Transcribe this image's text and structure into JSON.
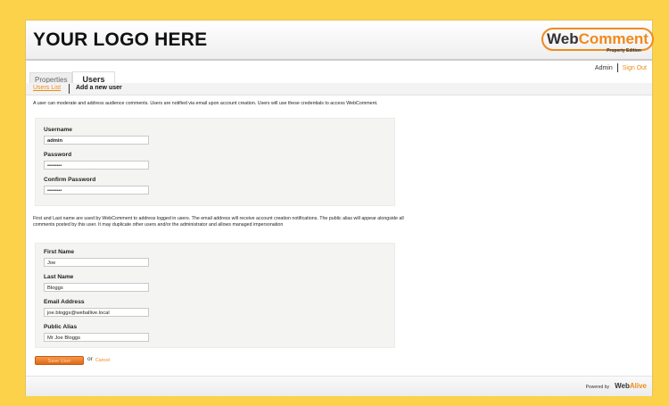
{
  "header": {
    "logo_text": "YOUR LOGO HERE",
    "brand_web": "Web",
    "brand_comment": "Comment",
    "brand_subtitle": "Property Edition"
  },
  "tabs": [
    {
      "label": "Properties",
      "active": false
    },
    {
      "label": "Users",
      "active": true
    }
  ],
  "user_menu": {
    "user": "Admin",
    "sign_out": "Sign Out"
  },
  "subnav": {
    "users_list": "Users List",
    "add_user": "Add a new user"
  },
  "intro_text": "A user can moderate and address audience comments.  Users are notified via email upon account creation. Users will use these credentials to access WebComment.",
  "credentials": {
    "username_label": "Username",
    "username_value": "admin",
    "password_label": "Password",
    "password_value": "••••••••",
    "confirm_label": "Confirm Password",
    "confirm_value": "••••••••"
  },
  "details_text": "First and Last name are used by WebComment to address logged in users. The email address will receive account creation notifications. The public alias will appear alongside all comments posted by this user.  It may duplicate other users and/or the administrator and allows managed impersonation",
  "details": {
    "first_name_label": "First Name",
    "first_name_value": "Joe",
    "last_name_label": "Last Name",
    "last_name_value": "Bloggs",
    "email_label": "Email Address",
    "email_value": "joe.bloggs@weballive.local",
    "alias_label": "Public Alias",
    "alias_value": "Mr Joe Bloggs"
  },
  "actions": {
    "save": "Save User",
    "or": "or",
    "cancel": "Cancel"
  },
  "footer": {
    "powered_by": "Powered by",
    "brand_web": "Web",
    "brand_alive": "Alive"
  },
  "colors": {
    "accent": "#f08a1c",
    "page_bg": "#fcd24a",
    "panel_bg": "#f4f4f2"
  }
}
